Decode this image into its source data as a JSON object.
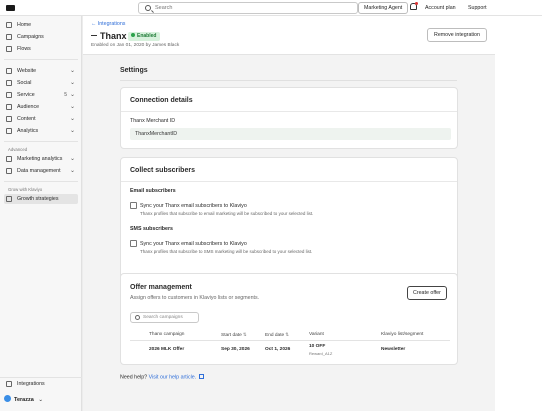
{
  "topbar": {
    "search_placeholder": "Search",
    "marketing_agent": "Marketing Agent",
    "account_plan": "Account plan",
    "support": "Support"
  },
  "sidebar": {
    "items_top": [
      {
        "label": "Home",
        "icon": "home-icon"
      },
      {
        "label": "Campaigns",
        "icon": "campaigns-icon"
      },
      {
        "label": "Flows",
        "icon": "flows-icon"
      }
    ],
    "items_main": [
      {
        "label": "Website",
        "icon": "website-icon"
      },
      {
        "label": "Social",
        "icon": "social-icon"
      },
      {
        "label": "Service",
        "icon": "service-icon",
        "count": "5"
      },
      {
        "label": "Audience",
        "icon": "audience-icon"
      },
      {
        "label": "Content",
        "icon": "content-icon"
      },
      {
        "label": "Analytics",
        "icon": "analytics-icon"
      }
    ],
    "advanced_label": "Advanced",
    "items_advanced": [
      {
        "label": "Marketing analytics",
        "icon": "marketing-analytics-icon"
      },
      {
        "label": "Data management",
        "icon": "data-management-icon"
      }
    ],
    "grow_label": "Grow with Klaviyo",
    "growth_item": {
      "label": "Growth strategies",
      "icon": "growth-icon"
    },
    "integrations": {
      "label": "Integrations",
      "icon": "integrations-icon"
    },
    "org_name": "Terazza"
  },
  "header": {
    "back_link": "← Integrations",
    "title": "Thanx",
    "status": "Enabled",
    "subtitle": "Enabled on Jan 01, 2020 by James Black",
    "remove_button": "Remove integration"
  },
  "settings": {
    "title": "Settings",
    "connection": {
      "title": "Connection details",
      "field_label": "Thanx Merchant ID",
      "field_value": "ThanxMerchantID"
    },
    "subscribers": {
      "title": "Collect subscribers",
      "email_heading": "Email subscribers",
      "email_checkbox": "Sync your Thanx email subscribers to Klaviyo",
      "email_help": "Thanx profiles that subscribe to email marketing will be subscribed to your selected list.",
      "sms_heading": "SMS subscribers",
      "sms_checkbox": "Sync your Thanx email subscribers to Klaviyo",
      "sms_help": "Thanx profiles that subscribe to SMS marketing will be subscribed to your selected list."
    },
    "offers": {
      "title": "Offer management",
      "subtitle": "Assign offers to customers in Klaviyo lists or segments.",
      "create_button": "Create offer",
      "search_placeholder": "Search campaigns",
      "columns": [
        "Thanx campaign",
        "Start date",
        "End date",
        "Variant",
        "Klaviyo list/segment"
      ],
      "rows": [
        {
          "campaign": "2026 MLK Offer",
          "start": "Sep 30, 2026",
          "end": "Oct 1, 2026",
          "variant": "10 OFF",
          "variant_sub": "Reward_A1Z",
          "list": "Newsletter"
        }
      ]
    }
  },
  "help": {
    "prefix": "Need help?",
    "link": "Visit our help article."
  },
  "colors": {
    "accent": "#2f6ed8",
    "enabled_bg": "#d7f1dc",
    "enabled_text": "#1e7a36"
  }
}
